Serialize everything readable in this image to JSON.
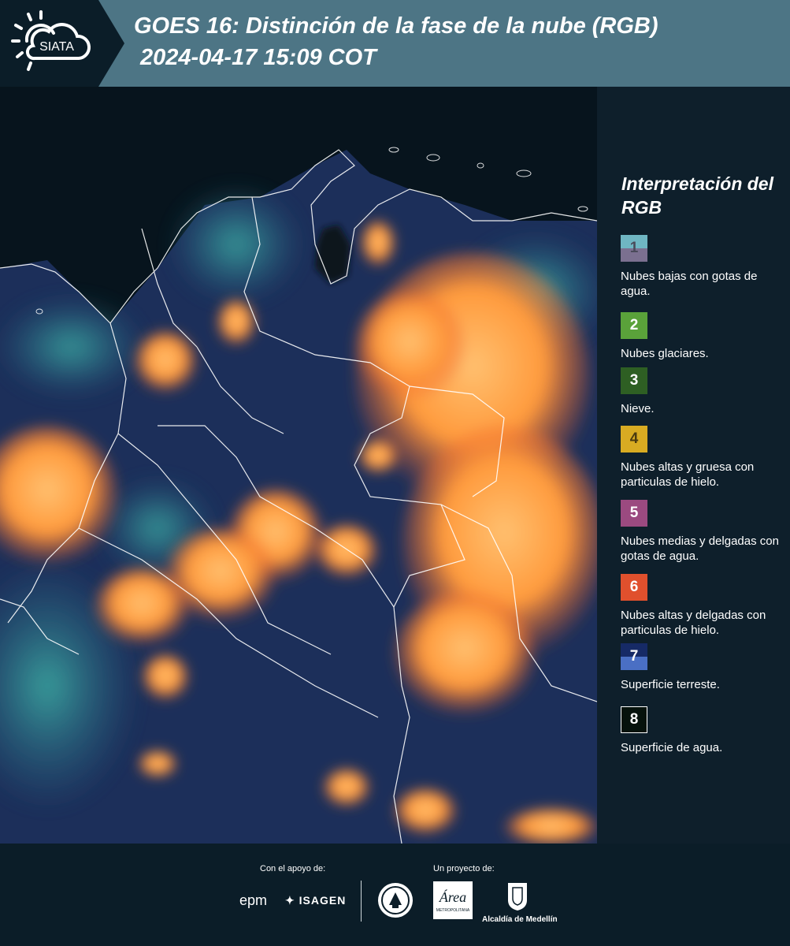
{
  "header": {
    "logo_text": "SIATA",
    "title": "GOES 16: Distinción de la fase de la nube (RGB)",
    "subtitle": "2024-04-17 15:09 COT"
  },
  "legend": {
    "title": "Interpretación del RGB",
    "items": [
      {
        "num": "1",
        "label": "Nubes bajas con gotas de agua.",
        "color_top": "#6fb6c3",
        "color_bottom": "#7b7090",
        "num_color": "#4a4a5a"
      },
      {
        "num": "2",
        "label": "Nubes glaciares.",
        "color_top": "#5aa23a",
        "color_bottom": "#5aa23a",
        "num_color": "#ffffff"
      },
      {
        "num": "3",
        "label": "Nieve.",
        "color_top": "#2e5f23",
        "color_bottom": "#2e5f23",
        "num_color": "#ffffff"
      },
      {
        "num": "4",
        "label": "Nubes altas y gruesa con particulas de hielo.",
        "color_top": "#d8ab22",
        "color_bottom": "#d8ab22",
        "num_color": "#4a3a10"
      },
      {
        "num": "5",
        "label": "Nubes medias y delgadas con gotas de agua.",
        "color_top": "#9b4a80",
        "color_bottom": "#9b4a80",
        "num_color": "#ffffff"
      },
      {
        "num": "6",
        "label": "Nubes altas y delgadas con particulas de hielo.",
        "color_top": "#e0502d",
        "color_bottom": "#e0502d",
        "num_color": "#ffffff"
      },
      {
        "num": "7",
        "label": "Superficie terreste.",
        "color_top": "#162a66",
        "color_bottom": "#4a6fc4",
        "num_color": "#ffffff"
      },
      {
        "num": "8",
        "label": "Superficie de agua.",
        "color_top": "#06120c",
        "color_bottom": "#06120c",
        "num_color": "#ffffff",
        "border": "#ffffff"
      }
    ]
  },
  "footer": {
    "support_label": "Con el apoyo de:",
    "project_label": "Un proyecto de:",
    "sponsors": [
      "epm",
      "ISAGEN"
    ],
    "metro_text": "Área",
    "metro_subtext": "METROPOLITANA",
    "alcaldia_label": "Alcaldía de Medellín"
  },
  "colors": {
    "header_bg": "#4d7585",
    "panel_bg": "#0e1f2b",
    "cloud_orange": "#ff9a3c",
    "land_blue": "#1c2f5a",
    "water_dark": "#07141d",
    "border_white": "#ffffff"
  }
}
